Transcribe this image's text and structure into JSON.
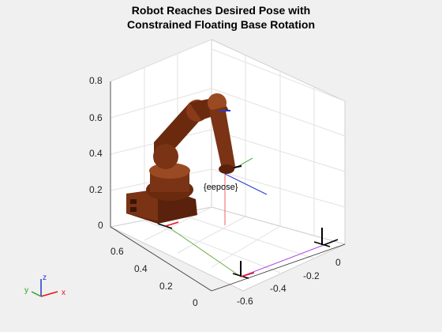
{
  "figure": {
    "title_line1": "Robot Reaches Desired Pose with",
    "title_line2": "Constrained Floating Base Rotation",
    "frame_label": "{eepose}",
    "z_ticks": [
      "0.8",
      "0.6",
      "0.4",
      "0.2",
      "0"
    ],
    "y_ticks": [
      "0.6",
      "0.4",
      "0.2",
      "0"
    ],
    "x_ticks": [
      "-0.6",
      "-0.4",
      "-0.2",
      "0"
    ],
    "triad": {
      "x": "x",
      "y": "y",
      "z": "z"
    },
    "colors": {
      "background": "#f0f0f0",
      "axes_face": "#ffffff",
      "grid": "#e2e2e2",
      "robot": "#6b2a0e",
      "robot_highlight": "#9a4a22",
      "x_axis": "#e0141e",
      "y_axis": "#2aa02a",
      "z_axis": "#1f3ad0"
    }
  }
}
